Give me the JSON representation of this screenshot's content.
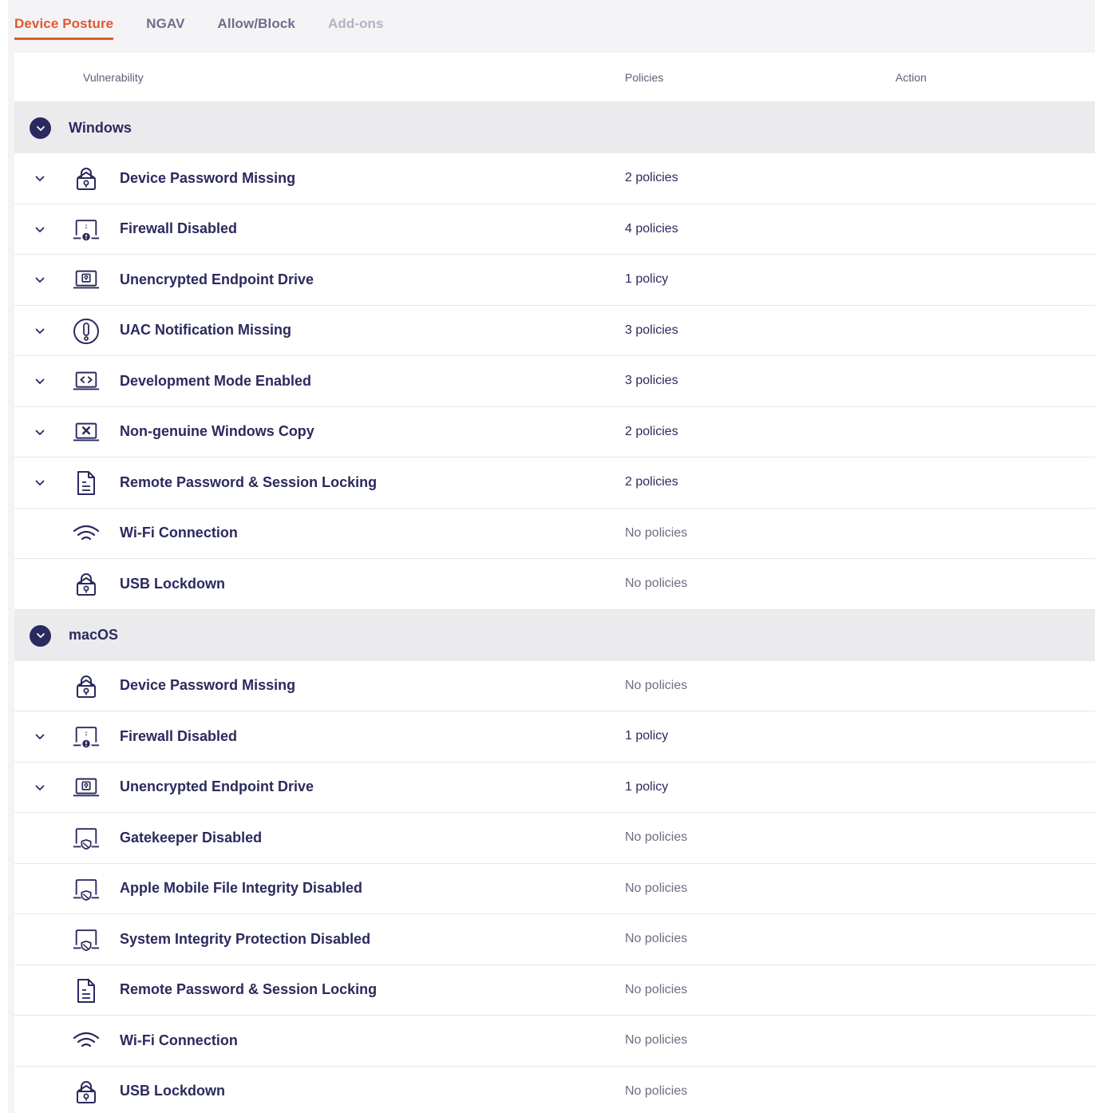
{
  "tabs": {
    "device_posture": "Device Posture",
    "ngav": "NGAV",
    "allow_block": "Allow/Block",
    "addons": "Add-ons"
  },
  "table": {
    "col_vulnerability": "Vulnerability",
    "col_policies": "Policies",
    "col_action": "Action"
  },
  "windows": {
    "title": "Windows",
    "rows": [
      {
        "label": "Device Password Missing",
        "policies": "2 policies",
        "icon": "lock-icon"
      },
      {
        "label": "Firewall Disabled",
        "policies": "4 policies",
        "icon": "laptop-alert-icon"
      },
      {
        "label": "Unencrypted Endpoint Drive",
        "policies": "1 policy",
        "icon": "laptop-key-icon"
      },
      {
        "label": "UAC Notification Missing",
        "policies": "3 policies",
        "icon": "exclamation-circle-icon"
      },
      {
        "label": "Development Mode Enabled",
        "policies": "3 policies",
        "icon": "laptop-code-icon"
      },
      {
        "label": "Non-genuine Windows Copy",
        "policies": "2 policies",
        "icon": "laptop-x-icon"
      },
      {
        "label": "Remote Password & Session Locking",
        "policies": "2 policies",
        "icon": "document-icon"
      },
      {
        "label": "Wi-Fi Connection",
        "policies": "No policies",
        "icon": "wifi-icon"
      },
      {
        "label": "USB Lockdown",
        "policies": "No policies",
        "icon": "lock-icon"
      }
    ]
  },
  "macos": {
    "title": "macOS",
    "rows": [
      {
        "label": "Device Password Missing",
        "policies": "No policies",
        "icon": "lock-icon"
      },
      {
        "label": "Firewall Disabled",
        "policies": "1 policy",
        "icon": "laptop-alert-icon"
      },
      {
        "label": "Unencrypted Endpoint Drive",
        "policies": "1 policy",
        "icon": "laptop-key-icon"
      },
      {
        "label": "Gatekeeper Disabled",
        "policies": "No policies",
        "icon": "laptop-shield-icon"
      },
      {
        "label": "Apple Mobile File Integrity Disabled",
        "policies": "No policies",
        "icon": "laptop-shield-icon"
      },
      {
        "label": "System Integrity Protection Disabled",
        "policies": "No policies",
        "icon": "laptop-shield-icon"
      },
      {
        "label": "Remote Password & Session Locking",
        "policies": "No policies",
        "icon": "document-icon"
      },
      {
        "label": "Wi-Fi Connection",
        "policies": "No policies",
        "icon": "wifi-icon"
      },
      {
        "label": "USB Lockdown",
        "policies": "No policies",
        "icon": "lock-icon"
      }
    ]
  },
  "colors": {
    "accent": "#e2572e",
    "primary_text": "#2b2a5e",
    "group_background": "#ebebee"
  }
}
